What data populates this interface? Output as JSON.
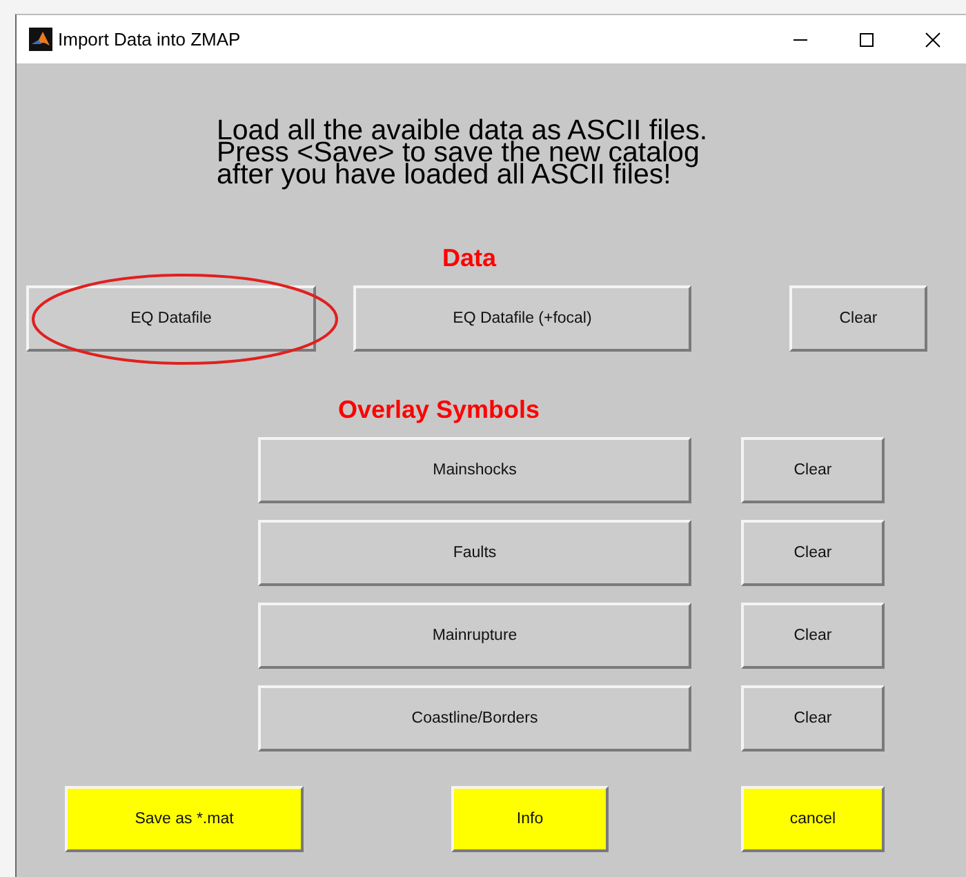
{
  "window": {
    "title": "Import Data into ZMAP"
  },
  "instructions": [
    "Load all the avaible data as ASCII files.",
    "Press <Save> to save the new catalog",
    "after you have loaded all ASCII files!"
  ],
  "data_section": {
    "heading": "Data",
    "buttons": [
      {
        "label": "EQ Datafile",
        "highlighted": true
      },
      {
        "label": "EQ Datafile (+focal)",
        "highlighted": false
      },
      {
        "label": "Clear",
        "highlighted": false
      }
    ]
  },
  "overlay_section": {
    "heading": "Overlay Symbols",
    "rows": [
      {
        "label": "Mainshocks",
        "clear": "Clear"
      },
      {
        "label": "Faults",
        "clear": "Clear"
      },
      {
        "label": "Mainrupture",
        "clear": "Clear"
      },
      {
        "label": "Coastline/Borders",
        "clear": "Clear"
      }
    ]
  },
  "bottom_buttons": [
    "Save as *.mat",
    "Info",
    "cancel"
  ]
}
